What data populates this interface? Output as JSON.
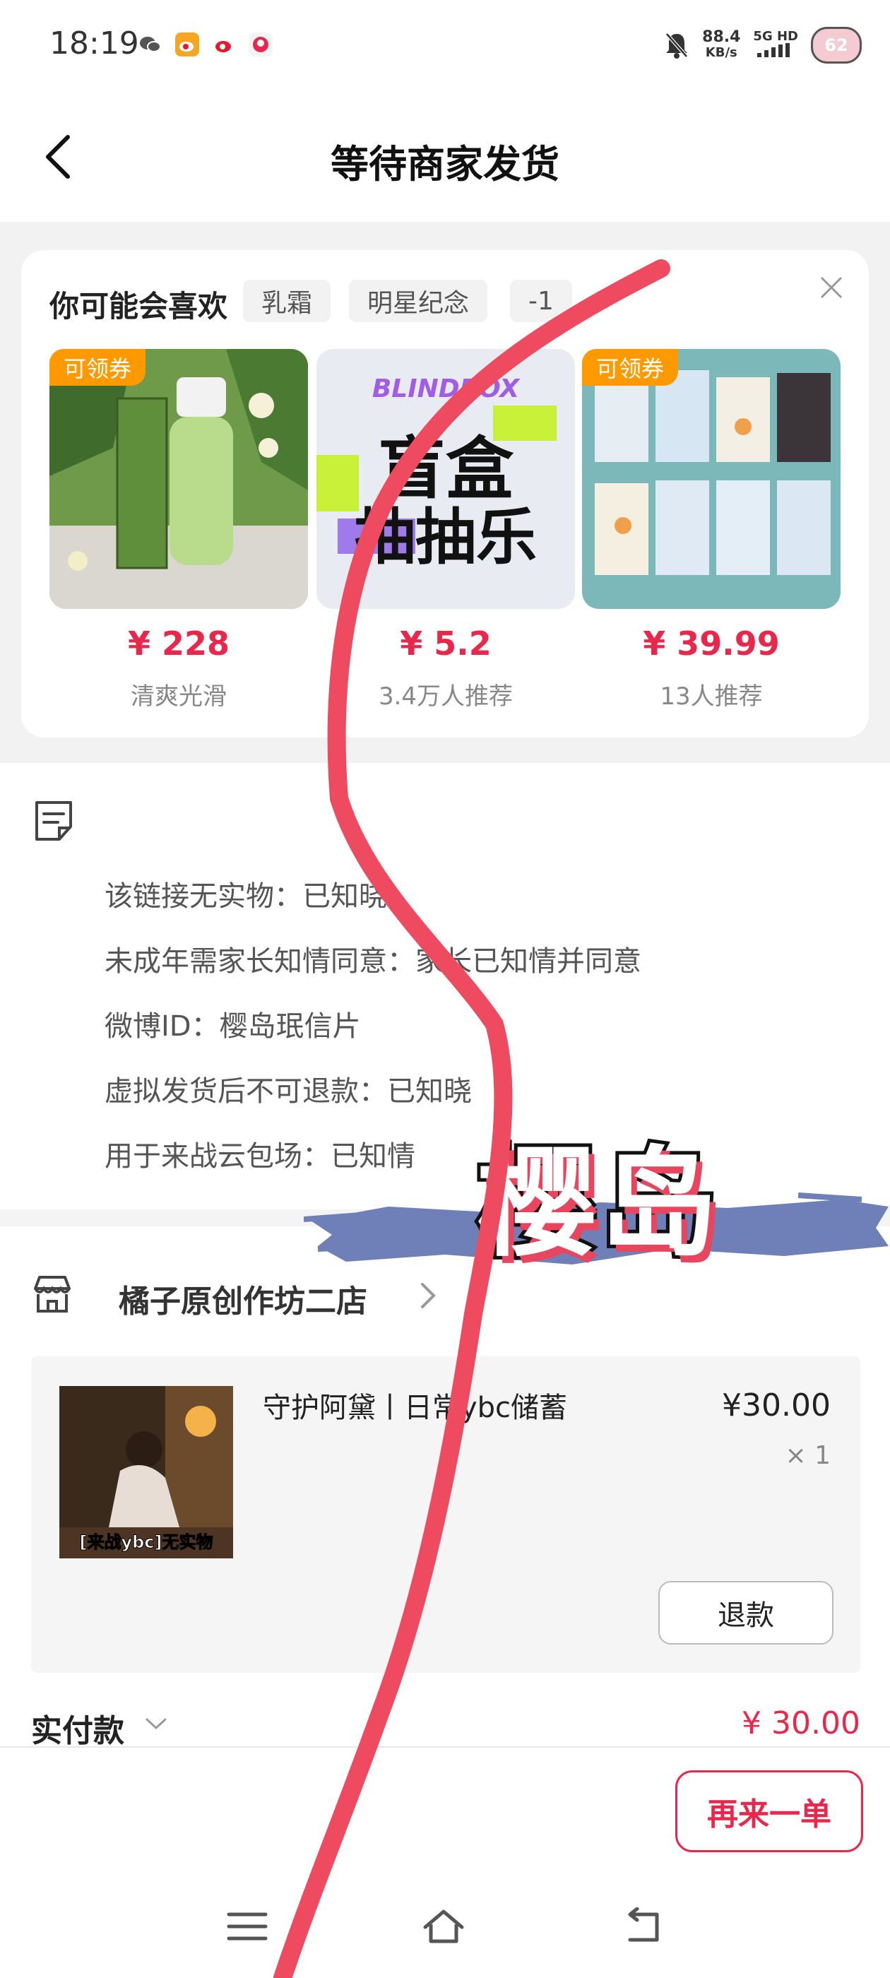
{
  "status_bar": {
    "time": "18:19",
    "net_speed_value": "88.4",
    "net_speed_unit": "KB/s",
    "signal_label": "5G HD",
    "battery": "62"
  },
  "header": {
    "title": "等待商家发货"
  },
  "recommendations": {
    "title": "你可能会喜欢",
    "tags": [
      "乳霜",
      "明星纪念",
      "-1"
    ],
    "products": [
      {
        "coupon": "可领券",
        "price": "¥ 228",
        "subtitle": "清爽光滑"
      },
      {
        "coupon": "",
        "price": "¥ 5.2",
        "subtitle": "3.4万人推荐",
        "image_text_top": "BLINDBOX",
        "image_text_main": "盲盒",
        "image_text_sub": "抽抽乐"
      },
      {
        "coupon": "可领券",
        "price": "¥ 39.99",
        "subtitle": "13人推荐"
      }
    ]
  },
  "notes": [
    "该链接无实物：已知晓",
    "未成年需家长知情同意：家长已知情并同意",
    "微博ID：樱岛珉信片",
    "虚拟发货后不可退款：已知晓",
    "用于来战云包场：已知情"
  ],
  "banner": {
    "text": "樱岛"
  },
  "shop": {
    "name": "橘子原创作坊二店"
  },
  "order_item": {
    "title": "守护阿黛丨日常ybc储蓄",
    "price": "¥30.00",
    "quantity": "× 1",
    "image_caption": "[来战ybc]无实物",
    "refund_label": "退款"
  },
  "payment": {
    "label": "实付款",
    "amount": "¥ 30.00"
  },
  "actions": {
    "reorder_label": "再来一单"
  },
  "colors": {
    "accent": "#e8274b",
    "coupon": "#ff9900",
    "brush": "#6f80b8",
    "overlay_line": "#ee4a60"
  }
}
